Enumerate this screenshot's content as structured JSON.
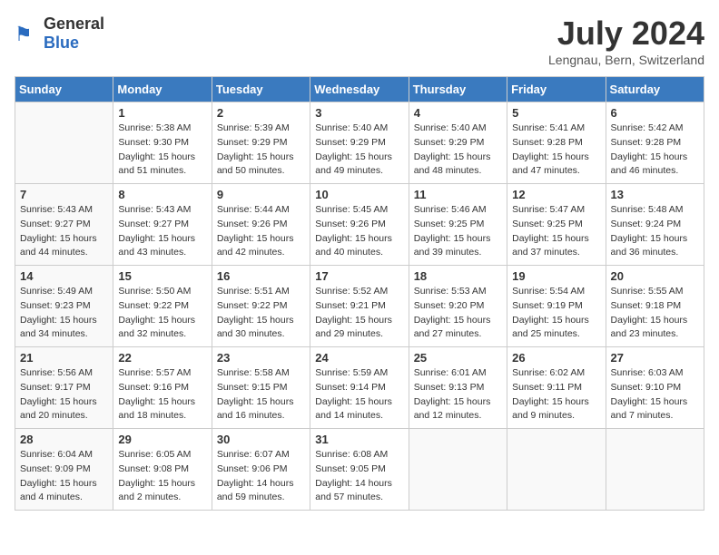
{
  "header": {
    "logo_general": "General",
    "logo_blue": "Blue",
    "title": "July 2024",
    "location": "Lengnau, Bern, Switzerland"
  },
  "days_of_week": [
    "Sunday",
    "Monday",
    "Tuesday",
    "Wednesday",
    "Thursday",
    "Friday",
    "Saturday"
  ],
  "weeks": [
    [
      {
        "day": "",
        "info": ""
      },
      {
        "day": "1",
        "info": "Sunrise: 5:38 AM\nSunset: 9:30 PM\nDaylight: 15 hours\nand 51 minutes."
      },
      {
        "day": "2",
        "info": "Sunrise: 5:39 AM\nSunset: 9:29 PM\nDaylight: 15 hours\nand 50 minutes."
      },
      {
        "day": "3",
        "info": "Sunrise: 5:40 AM\nSunset: 9:29 PM\nDaylight: 15 hours\nand 49 minutes."
      },
      {
        "day": "4",
        "info": "Sunrise: 5:40 AM\nSunset: 9:29 PM\nDaylight: 15 hours\nand 48 minutes."
      },
      {
        "day": "5",
        "info": "Sunrise: 5:41 AM\nSunset: 9:28 PM\nDaylight: 15 hours\nand 47 minutes."
      },
      {
        "day": "6",
        "info": "Sunrise: 5:42 AM\nSunset: 9:28 PM\nDaylight: 15 hours\nand 46 minutes."
      }
    ],
    [
      {
        "day": "7",
        "info": "Sunrise: 5:43 AM\nSunset: 9:27 PM\nDaylight: 15 hours\nand 44 minutes."
      },
      {
        "day": "8",
        "info": "Sunrise: 5:43 AM\nSunset: 9:27 PM\nDaylight: 15 hours\nand 43 minutes."
      },
      {
        "day": "9",
        "info": "Sunrise: 5:44 AM\nSunset: 9:26 PM\nDaylight: 15 hours\nand 42 minutes."
      },
      {
        "day": "10",
        "info": "Sunrise: 5:45 AM\nSunset: 9:26 PM\nDaylight: 15 hours\nand 40 minutes."
      },
      {
        "day": "11",
        "info": "Sunrise: 5:46 AM\nSunset: 9:25 PM\nDaylight: 15 hours\nand 39 minutes."
      },
      {
        "day": "12",
        "info": "Sunrise: 5:47 AM\nSunset: 9:25 PM\nDaylight: 15 hours\nand 37 minutes."
      },
      {
        "day": "13",
        "info": "Sunrise: 5:48 AM\nSunset: 9:24 PM\nDaylight: 15 hours\nand 36 minutes."
      }
    ],
    [
      {
        "day": "14",
        "info": "Sunrise: 5:49 AM\nSunset: 9:23 PM\nDaylight: 15 hours\nand 34 minutes."
      },
      {
        "day": "15",
        "info": "Sunrise: 5:50 AM\nSunset: 9:22 PM\nDaylight: 15 hours\nand 32 minutes."
      },
      {
        "day": "16",
        "info": "Sunrise: 5:51 AM\nSunset: 9:22 PM\nDaylight: 15 hours\nand 30 minutes."
      },
      {
        "day": "17",
        "info": "Sunrise: 5:52 AM\nSunset: 9:21 PM\nDaylight: 15 hours\nand 29 minutes."
      },
      {
        "day": "18",
        "info": "Sunrise: 5:53 AM\nSunset: 9:20 PM\nDaylight: 15 hours\nand 27 minutes."
      },
      {
        "day": "19",
        "info": "Sunrise: 5:54 AM\nSunset: 9:19 PM\nDaylight: 15 hours\nand 25 minutes."
      },
      {
        "day": "20",
        "info": "Sunrise: 5:55 AM\nSunset: 9:18 PM\nDaylight: 15 hours\nand 23 minutes."
      }
    ],
    [
      {
        "day": "21",
        "info": "Sunrise: 5:56 AM\nSunset: 9:17 PM\nDaylight: 15 hours\nand 20 minutes."
      },
      {
        "day": "22",
        "info": "Sunrise: 5:57 AM\nSunset: 9:16 PM\nDaylight: 15 hours\nand 18 minutes."
      },
      {
        "day": "23",
        "info": "Sunrise: 5:58 AM\nSunset: 9:15 PM\nDaylight: 15 hours\nand 16 minutes."
      },
      {
        "day": "24",
        "info": "Sunrise: 5:59 AM\nSunset: 9:14 PM\nDaylight: 15 hours\nand 14 minutes."
      },
      {
        "day": "25",
        "info": "Sunrise: 6:01 AM\nSunset: 9:13 PM\nDaylight: 15 hours\nand 12 minutes."
      },
      {
        "day": "26",
        "info": "Sunrise: 6:02 AM\nSunset: 9:11 PM\nDaylight: 15 hours\nand 9 minutes."
      },
      {
        "day": "27",
        "info": "Sunrise: 6:03 AM\nSunset: 9:10 PM\nDaylight: 15 hours\nand 7 minutes."
      }
    ],
    [
      {
        "day": "28",
        "info": "Sunrise: 6:04 AM\nSunset: 9:09 PM\nDaylight: 15 hours\nand 4 minutes."
      },
      {
        "day": "29",
        "info": "Sunrise: 6:05 AM\nSunset: 9:08 PM\nDaylight: 15 hours\nand 2 minutes."
      },
      {
        "day": "30",
        "info": "Sunrise: 6:07 AM\nSunset: 9:06 PM\nDaylight: 14 hours\nand 59 minutes."
      },
      {
        "day": "31",
        "info": "Sunrise: 6:08 AM\nSunset: 9:05 PM\nDaylight: 14 hours\nand 57 minutes."
      },
      {
        "day": "",
        "info": ""
      },
      {
        "day": "",
        "info": ""
      },
      {
        "day": "",
        "info": ""
      }
    ]
  ]
}
